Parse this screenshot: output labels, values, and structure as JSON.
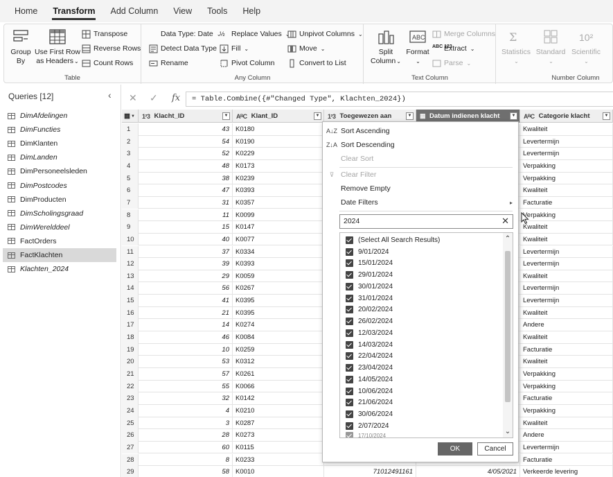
{
  "menu": {
    "tabs": [
      "Home",
      "Transform",
      "Add Column",
      "View",
      "Tools",
      "Help"
    ],
    "active": "Transform"
  },
  "ribbon": {
    "table": {
      "label": "Table",
      "group_by": [
        "Group",
        "By"
      ],
      "use_first_row": [
        "Use First Row",
        "as Headers"
      ],
      "transpose": "Transpose",
      "reverse_rows": "Reverse Rows",
      "count_rows": "Count Rows"
    },
    "any_column": {
      "label": "Any Column",
      "data_type": "Data Type: Date",
      "detect_data_type": "Detect Data Type",
      "rename": "Rename",
      "replace_values": "Replace Values",
      "fill": "Fill",
      "pivot_column": "Pivot Column",
      "unpivot_columns": "Unpivot Columns",
      "move": "Move",
      "convert_to_list": "Convert to List"
    },
    "text_column": {
      "label": "Text Column",
      "split_column": [
        "Split",
        "Column"
      ],
      "format": "Format",
      "merge_columns": "Merge Columns",
      "extract": "Extract",
      "parse": "Parse"
    },
    "number_column": {
      "label": "Number Column",
      "statistics": "Statistics",
      "standard": "Standard",
      "scientific": "Scientific"
    }
  },
  "queries": {
    "header": "Queries [12]",
    "items": [
      {
        "name": "DimAfdelingen",
        "italic": true
      },
      {
        "name": "DimFuncties",
        "italic": true
      },
      {
        "name": "DimKlanten",
        "italic": false
      },
      {
        "name": "DimLanden",
        "italic": true
      },
      {
        "name": "DimPersoneelsleden",
        "italic": false
      },
      {
        "name": "DimPostcodes",
        "italic": true
      },
      {
        "name": "DimProducten",
        "italic": false
      },
      {
        "name": "DimScholingsgraad",
        "italic": true
      },
      {
        "name": "DimWerelddeel",
        "italic": true
      },
      {
        "name": "FactOrders",
        "italic": false
      },
      {
        "name": "FactKlachten",
        "italic": false,
        "selected": true
      },
      {
        "name": "Klachten_2024",
        "italic": true
      }
    ]
  },
  "formula": {
    "fx": "fx",
    "text": "= Table.Combine({#\"Changed Type\", Klachten_2024})"
  },
  "table": {
    "columns": [
      {
        "type": "1²3",
        "name": "Klacht_ID"
      },
      {
        "type": "AᴮC",
        "name": "Klant_ID"
      },
      {
        "type": "1²3",
        "name": "Toegewezen aan"
      },
      {
        "type": "▦",
        "name": "Datum indienen klacht"
      },
      {
        "type": "AᴮC",
        "name": "Categorie klacht"
      }
    ],
    "rows": [
      {
        "i": "1",
        "kid": "43",
        "klant": "K0180",
        "toeg": "",
        "dat": "",
        "cat": "Kwaliteit"
      },
      {
        "i": "2",
        "kid": "54",
        "klant": "K0190",
        "toeg": "",
        "dat": "",
        "cat": "Levertermijn"
      },
      {
        "i": "3",
        "kid": "52",
        "klant": "K0229",
        "toeg": "",
        "dat": "",
        "cat": "Levertermijn"
      },
      {
        "i": "4",
        "kid": "48",
        "klant": "K0173",
        "toeg": "",
        "dat": "",
        "cat": "Verpakking"
      },
      {
        "i": "5",
        "kid": "38",
        "klant": "K0239",
        "toeg": "",
        "dat": "",
        "cat": "Verpakking"
      },
      {
        "i": "6",
        "kid": "47",
        "klant": "K0393",
        "toeg": "",
        "dat": "",
        "cat": "Kwaliteit"
      },
      {
        "i": "7",
        "kid": "31",
        "klant": "K0357",
        "toeg": "",
        "dat": "",
        "cat": "Facturatie"
      },
      {
        "i": "8",
        "kid": "11",
        "klant": "K0099",
        "toeg": "",
        "dat": "",
        "cat": "Verpakking"
      },
      {
        "i": "9",
        "kid": "15",
        "klant": "K0147",
        "toeg": "",
        "dat": "",
        "cat": "Kwaliteit"
      },
      {
        "i": "10",
        "kid": "40",
        "klant": "K0077",
        "toeg": "",
        "dat": "",
        "cat": "Kwaliteit"
      },
      {
        "i": "11",
        "kid": "37",
        "klant": "K0334",
        "toeg": "",
        "dat": "",
        "cat": "Levertermijn"
      },
      {
        "i": "12",
        "kid": "39",
        "klant": "K0393",
        "toeg": "",
        "dat": "",
        "cat": "Levertermijn"
      },
      {
        "i": "13",
        "kid": "29",
        "klant": "K0059",
        "toeg": "",
        "dat": "",
        "cat": "Kwaliteit"
      },
      {
        "i": "14",
        "kid": "56",
        "klant": "K0267",
        "toeg": "",
        "dat": "",
        "cat": "Levertermijn"
      },
      {
        "i": "15",
        "kid": "41",
        "klant": "K0395",
        "toeg": "",
        "dat": "",
        "cat": "Levertermijn"
      },
      {
        "i": "16",
        "kid": "21",
        "klant": "K0395",
        "toeg": "",
        "dat": "",
        "cat": "Kwaliteit"
      },
      {
        "i": "17",
        "kid": "14",
        "klant": "K0274",
        "toeg": "",
        "dat": "",
        "cat": "Andere"
      },
      {
        "i": "18",
        "kid": "46",
        "klant": "K0084",
        "toeg": "",
        "dat": "",
        "cat": "Kwaliteit"
      },
      {
        "i": "19",
        "kid": "10",
        "klant": "K0259",
        "toeg": "",
        "dat": "",
        "cat": "Facturatie"
      },
      {
        "i": "20",
        "kid": "53",
        "klant": "K0312",
        "toeg": "",
        "dat": "",
        "cat": "Kwaliteit"
      },
      {
        "i": "21",
        "kid": "57",
        "klant": "K0261",
        "toeg": "",
        "dat": "",
        "cat": "Verpakking"
      },
      {
        "i": "22",
        "kid": "55",
        "klant": "K0066",
        "toeg": "",
        "dat": "",
        "cat": "Verpakking"
      },
      {
        "i": "23",
        "kid": "32",
        "klant": "K0142",
        "toeg": "",
        "dat": "",
        "cat": "Facturatie"
      },
      {
        "i": "24",
        "kid": "4",
        "klant": "K0210",
        "toeg": "",
        "dat": "",
        "cat": "Verpakking"
      },
      {
        "i": "25",
        "kid": "3",
        "klant": "K0287",
        "toeg": "",
        "dat": "",
        "cat": "Kwaliteit"
      },
      {
        "i": "26",
        "kid": "28",
        "klant": "K0273",
        "toeg": "",
        "dat": "",
        "cat": "Andere"
      },
      {
        "i": "27",
        "kid": "60",
        "klant": "K0115",
        "toeg": "",
        "dat": "",
        "cat": "Levertermijn"
      },
      {
        "i": "28",
        "kid": "8",
        "klant": "K0233",
        "toeg": "",
        "dat": "",
        "cat": "Facturatie"
      },
      {
        "i": "29",
        "kid": "58",
        "klant": "K0010",
        "toeg": "71012491161",
        "dat": "4/05/2021",
        "cat": "Verkeerde levering"
      }
    ]
  },
  "filter_menu": {
    "sort_asc": "Sort Ascending",
    "sort_desc": "Sort Descending",
    "clear_sort": "Clear Sort",
    "clear_filter": "Clear Filter",
    "remove_empty": "Remove Empty",
    "date_filters": "Date Filters",
    "search_value": "2024",
    "select_all": "(Select All Search Results)",
    "values": [
      "9/01/2024",
      "15/01/2024",
      "29/01/2024",
      "30/01/2024",
      "31/01/2024",
      "20/02/2024",
      "26/02/2024",
      "12/03/2024",
      "14/03/2024",
      "22/04/2024",
      "23/04/2024",
      "14/05/2024",
      "10/06/2024",
      "21/06/2024",
      "30/06/2024",
      "2/07/2024"
    ],
    "ok": "OK",
    "cancel": "Cancel"
  }
}
